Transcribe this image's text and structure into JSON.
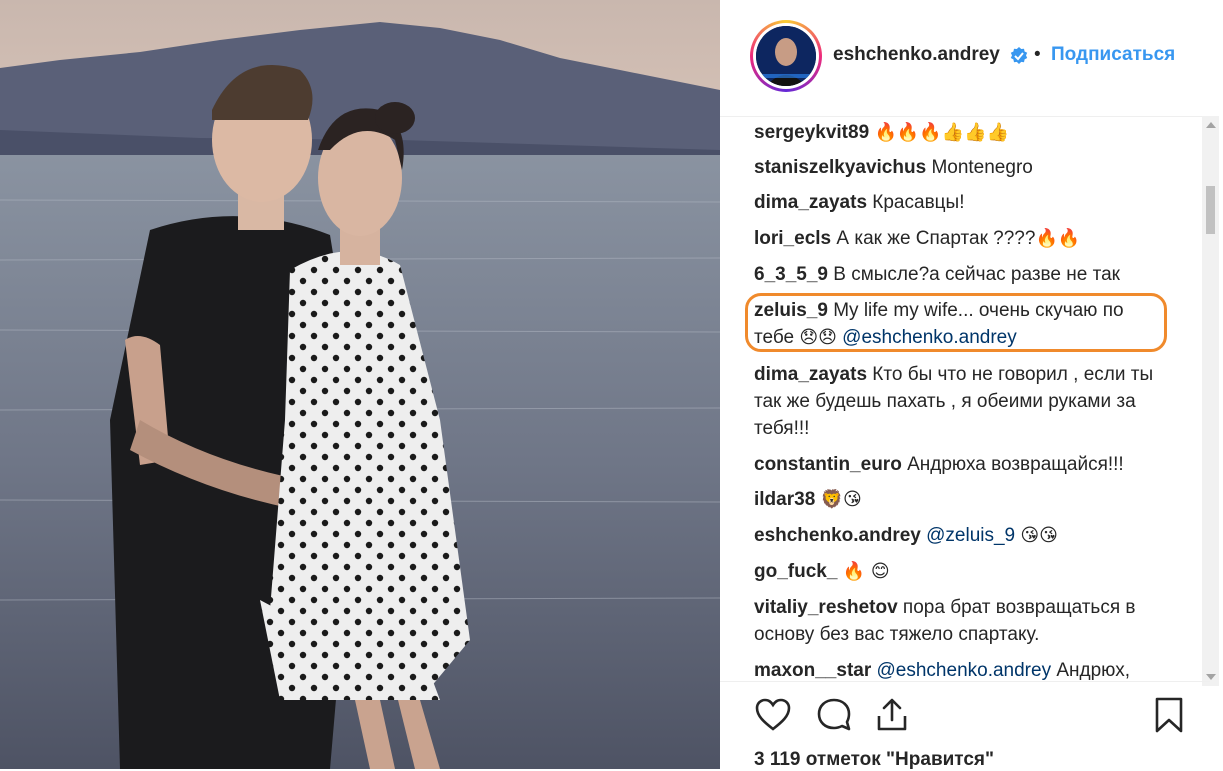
{
  "post": {
    "username": "eshchenko.andrey",
    "dot": "•",
    "follow_label": "Подписаться",
    "likes_text": "3 119 отметок \"Нравится\""
  },
  "comments": [
    {
      "user": "sergeykvit89",
      "text": "",
      "emoji": "🔥🔥🔥👍👍👍"
    },
    {
      "user": "staniszelkyavichus",
      "text": "Montenegro",
      "emoji": ""
    },
    {
      "user": "dima_zayats",
      "text": "Красавцы!",
      "emoji": ""
    },
    {
      "user": "lori_ecls",
      "text": "А как же Спартак ????",
      "emoji": "🔥🔥"
    },
    {
      "user": "6_3_5_9",
      "text": "В смысле?а сейчас разве не так",
      "emoji": ""
    },
    {
      "user": "zeluis_9",
      "text": "My life my wife... очень скучаю по тебе",
      "emoji": "😞😞",
      "mention": "@eshchenko.andrey"
    },
    {
      "user": "dima_zayats",
      "text": "Кто бы что не говорил , если ты так же будешь пахать , я обеими руками за тебя!!!",
      "emoji": ""
    },
    {
      "user": "constantin_euro",
      "text": "Андрюха возвращайся!!!",
      "emoji": ""
    },
    {
      "user": "ildar38",
      "text": "",
      "emoji": "🦁😘"
    },
    {
      "user": "eshchenko.andrey",
      "text": "",
      "emoji": "😘😘",
      "mention": "@zeluis_9"
    },
    {
      "user": "go_fuck_",
      "text": "",
      "emoji": "🔥 😊"
    },
    {
      "user": "vitaliy_reshetov",
      "text": "пора брат возвращаться в основу без вас тяжело спартаку.",
      "emoji": ""
    },
    {
      "user": "maxon__star",
      "text": "Андрюх,",
      "emoji": "",
      "mention": "@eshchenko.andrey"
    }
  ],
  "icons": {
    "like": "heart-icon",
    "comment": "comment-bubble-icon",
    "share": "share-icon",
    "save": "bookmark-icon",
    "verified": "verified-badge-icon"
  },
  "colors": {
    "link": "#3897f0",
    "mention": "#003569",
    "highlight": "#f08a2c",
    "verified": "#3897f0"
  }
}
